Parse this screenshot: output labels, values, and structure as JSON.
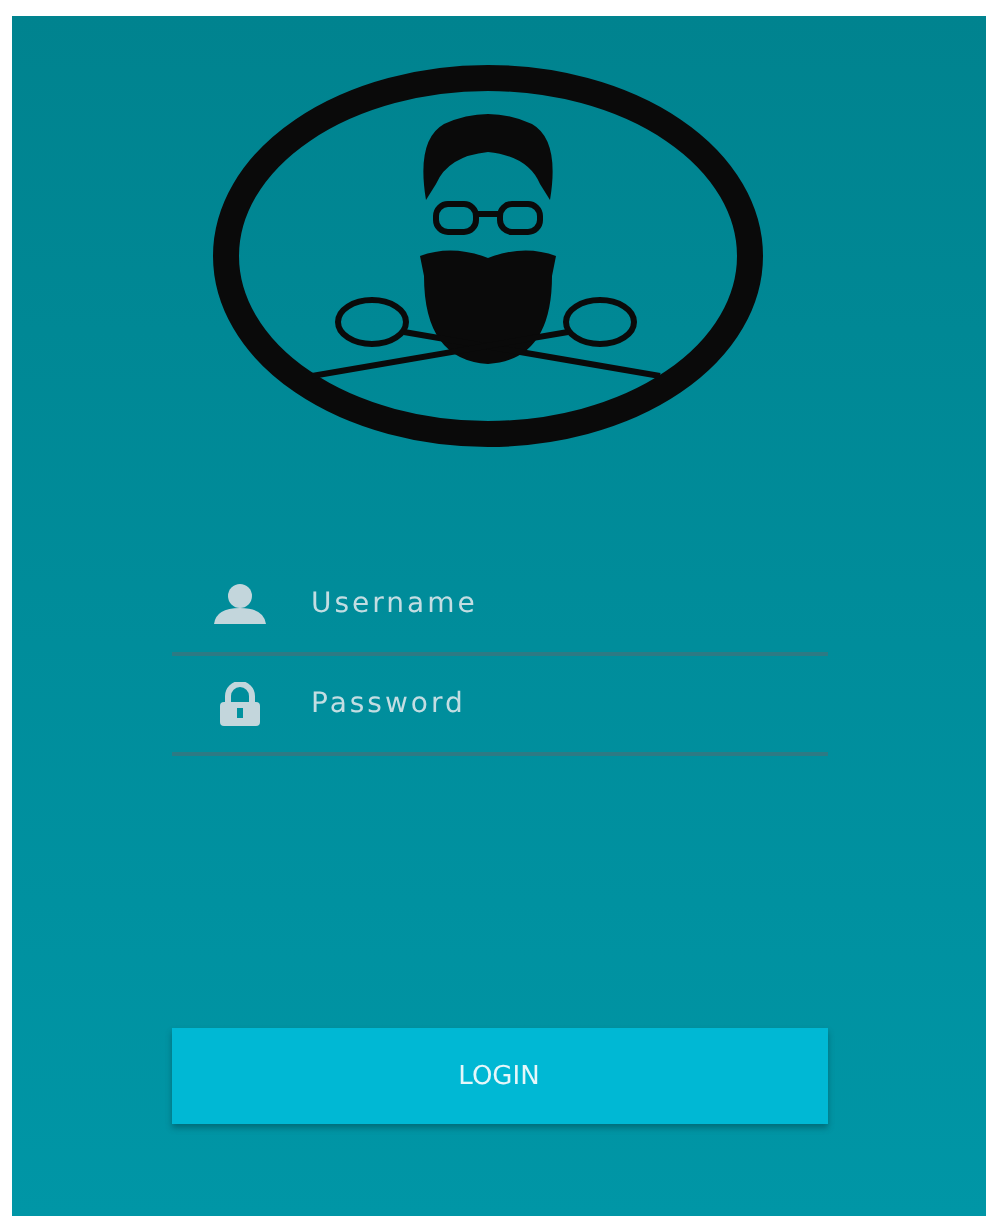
{
  "fields": [
    {
      "kind": "username",
      "placeholder": "Username"
    },
    {
      "kind": "password",
      "placeholder": "Password"
    }
  ],
  "login_button": {
    "label": "LOGIN"
  }
}
